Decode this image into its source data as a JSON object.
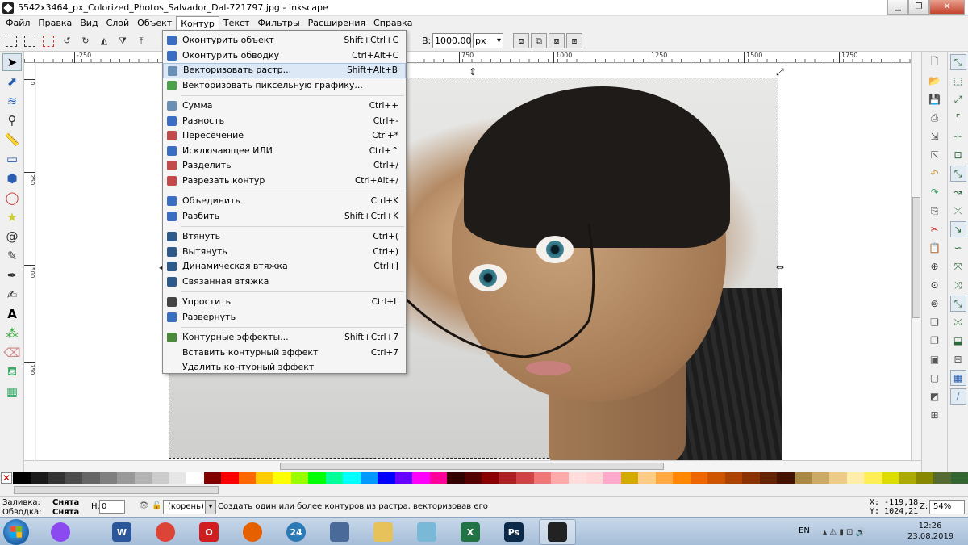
{
  "window": {
    "title": "5542x3464_px_Colorized_Photos_Salvador_Dal-721797.jpg - Inkscape"
  },
  "menubar": [
    "Файл",
    "Правка",
    "Вид",
    "Слой",
    "Объект",
    "Контур",
    "Текст",
    "Фильтры",
    "Расширения",
    "Справка"
  ],
  "menubar_active": "Контур",
  "toolbar": {
    "width_label": "В:",
    "width_value": "1000,00",
    "unit": "px"
  },
  "ruler": {
    "h_ticks": [
      "-250",
      "0",
      "250",
      "500",
      "750",
      "1000",
      "1250",
      "1500",
      "1750"
    ],
    "v_ticks": [
      "0",
      "250",
      "500",
      "750"
    ]
  },
  "dropdown": {
    "groups": [
      [
        {
          "label": "Оконтурить объект",
          "shortcut": "Shift+Ctrl+C",
          "icon_color": "#3a6ec2"
        },
        {
          "label": "Оконтурить обводку",
          "shortcut": "Ctrl+Alt+C",
          "icon_color": "#3a6ec2"
        },
        {
          "label": "Векторизовать растр...",
          "shortcut": "Shift+Alt+B",
          "icon_color": "#6a8fb4",
          "highlighted": true
        },
        {
          "label": "Векторизовать пиксельную графику...",
          "shortcut": "",
          "icon_color": "#4aa24a"
        }
      ],
      [
        {
          "label": "Сумма",
          "shortcut": "Ctrl++",
          "icon_color": "#6a8fb4"
        },
        {
          "label": "Разность",
          "shortcut": "Ctrl+-",
          "icon_color": "#3a6ec2"
        },
        {
          "label": "Пересечение",
          "shortcut": "Ctrl+*",
          "icon_color": "#c24a4a"
        },
        {
          "label": "Исключающее ИЛИ",
          "shortcut": "Ctrl+^",
          "icon_color": "#3a6ec2"
        },
        {
          "label": "Разделить",
          "shortcut": "Ctrl+/",
          "icon_color": "#c24a4a"
        },
        {
          "label": "Разрезать контур",
          "shortcut": "Ctrl+Alt+/",
          "icon_color": "#c24a4a"
        }
      ],
      [
        {
          "label": "Объединить",
          "shortcut": "Ctrl+K",
          "icon_color": "#3a6ec2"
        },
        {
          "label": "Разбить",
          "shortcut": "Shift+Ctrl+K",
          "icon_color": "#3a6ec2"
        }
      ],
      [
        {
          "label": "Втянуть",
          "shortcut": "Ctrl+(",
          "icon_color": "#2d5a8a"
        },
        {
          "label": "Вытянуть",
          "shortcut": "Ctrl+)",
          "icon_color": "#2d5a8a"
        },
        {
          "label": "Динамическая втяжка",
          "shortcut": "Ctrl+J",
          "icon_color": "#2d5a8a"
        },
        {
          "label": "Связанная втяжка",
          "shortcut": "",
          "icon_color": "#2d5a8a"
        }
      ],
      [
        {
          "label": "Упростить",
          "shortcut": "Ctrl+L",
          "icon_color": "#444444"
        },
        {
          "label": "Развернуть",
          "shortcut": "",
          "icon_color": "#3a6ec2"
        }
      ],
      [
        {
          "label": "Контурные эффекты...",
          "shortcut": "Shift+Ctrl+7",
          "icon_color": "#4a8a3a"
        },
        {
          "label": "Вставить контурный эффект",
          "shortcut": "Ctrl+7",
          "icon_color": "transparent"
        },
        {
          "label": "Удалить контурный эффект",
          "shortcut": "",
          "icon_color": "transparent"
        }
      ]
    ]
  },
  "palette_colors": [
    "#000000",
    "#1a1a1a",
    "#333333",
    "#4d4d4d",
    "#666666",
    "#808080",
    "#999999",
    "#b3b3b3",
    "#cccccc",
    "#e6e6e6",
    "#ffffff",
    "#800000",
    "#ff0000",
    "#ff6600",
    "#ffcc00",
    "#ffff00",
    "#99ff00",
    "#00ff00",
    "#00ff99",
    "#00ffff",
    "#0099ff",
    "#0000ff",
    "#6600ff",
    "#ff00ff",
    "#ff0099",
    "#330000",
    "#550000",
    "#880000",
    "#aa2222",
    "#cc4444",
    "#ee7777",
    "#ffaaaa",
    "#ffdddd",
    "#ffd5d5",
    "#ffaacc",
    "#d4aa00",
    "#ffcc88",
    "#ffaa44",
    "#ff8800",
    "#ee6600",
    "#cc5500",
    "#aa4400",
    "#883300",
    "#662200",
    "#441100",
    "#aa8844",
    "#ccaa66",
    "#eecc88",
    "#ffeeaa",
    "#ffee55",
    "#dddd00",
    "#aaaa00",
    "#888800",
    "#556b2f",
    "#336633"
  ],
  "status": {
    "fill_label": "Заливка:",
    "fill_value": "Снята",
    "stroke_label": "Обводка:",
    "stroke_value": "Снята",
    "h_label": "Н:",
    "h_value": "0",
    "layer": "(корень)",
    "message": "Создать один или более контуров из растра, векторизовав его",
    "x_coord": "X: -119,18",
    "y_coord": "Y: 1024,21",
    "zoom_label": "Z:",
    "zoom_value": "54%"
  },
  "taskbar": {
    "apps": [
      {
        "name": "alice",
        "label": "",
        "color": "#8a4af0"
      },
      {
        "name": "word",
        "label": "W",
        "color": "#2b579a"
      },
      {
        "name": "chrome",
        "label": "",
        "color": "#db4437"
      },
      {
        "name": "opera",
        "label": "O",
        "color": "#d01e1e"
      },
      {
        "name": "firefox",
        "label": "",
        "color": "#e66000"
      },
      {
        "name": "calendar",
        "label": "24",
        "color": "#2a7ab8"
      },
      {
        "name": "network",
        "label": "",
        "color": "#4a6a9a"
      },
      {
        "name": "explorer",
        "label": "",
        "color": "#e7c25a"
      },
      {
        "name": "notes",
        "label": "",
        "color": "#7ab8d8"
      },
      {
        "name": "excel",
        "label": "X",
        "color": "#217346"
      },
      {
        "name": "photoshop",
        "label": "Ps",
        "color": "#0b2a4a"
      },
      {
        "name": "inkscape",
        "label": "",
        "color": "#222222"
      }
    ],
    "lang": "EN",
    "time": "12:26",
    "date": "23.08.2019"
  }
}
